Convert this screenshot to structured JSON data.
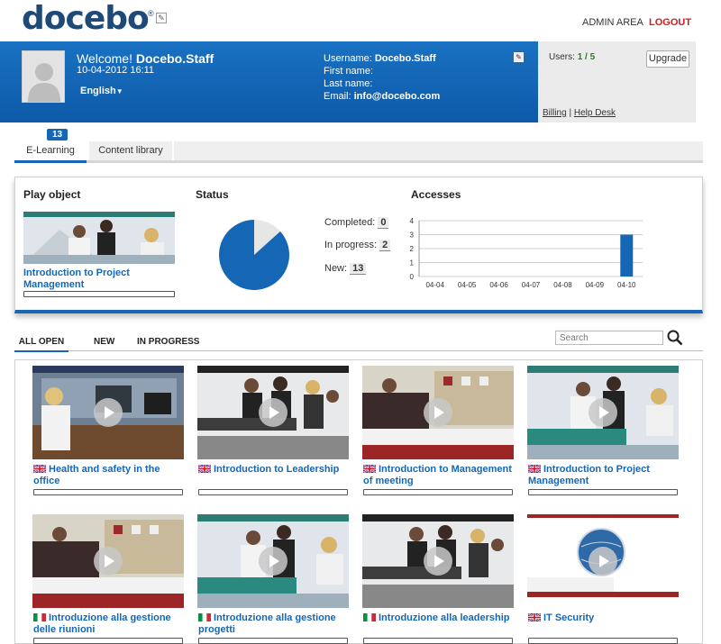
{
  "brand": {
    "logo_text": "docebo",
    "logo_mark": "®"
  },
  "topnav": {
    "admin": "ADMIN AREA",
    "logout": "LOGOUT"
  },
  "user": {
    "welcome_prefix": "Welcome!",
    "name": "Docebo.Staff",
    "datetime": "10-04-2012 16:11",
    "language": "English",
    "username_label": "Username:",
    "username": "Docebo.Staff",
    "first_name_label": "First name:",
    "last_name_label": "Last name:",
    "email_label": "Email:",
    "email": "info@docebo.com"
  },
  "side": {
    "users_label": "Users:",
    "users_count": "1 / 5",
    "upgrade": "Upgrade",
    "billing": "Billing",
    "separator": "|",
    "helpdesk": "Help Desk"
  },
  "tabs": {
    "badge": "13",
    "elearning": "E-Learning",
    "content_library": "Content library"
  },
  "dashboard": {
    "play_heading": "Play object",
    "status_heading": "Status",
    "accesses_heading": "Accesses",
    "play_title": "Introduction to Project Management",
    "completed_label": "Completed:",
    "completed": "0",
    "in_progress_label": "In progress:",
    "in_progress": "2",
    "new_label": "New:",
    "new": "13"
  },
  "chart_data": {
    "type": "bar",
    "categories": [
      "04-04",
      "04-05",
      "04-06",
      "04-07",
      "04-08",
      "04-09",
      "04-10"
    ],
    "values": [
      0,
      0,
      0,
      0,
      0,
      0,
      3
    ],
    "yticks": [
      0,
      1,
      2,
      3,
      4
    ],
    "ylim": [
      0,
      4
    ],
    "color": "#1567b6"
  },
  "status_pie": {
    "type": "pie",
    "labels": [
      "Completed",
      "In progress",
      "New"
    ],
    "values": [
      0,
      2,
      13
    ],
    "colors": [
      "#1567b6",
      "#e6e6e6",
      "#1567b6"
    ]
  },
  "filters": {
    "all": "ALL OPEN",
    "new": "NEW",
    "progress": "IN PROGRESS",
    "search_placeholder": "Search"
  },
  "courses": [
    {
      "title": "Health and safety in the office",
      "flag": "uk"
    },
    {
      "title": "Introduction to Leadership",
      "flag": "uk"
    },
    {
      "title": "Introduction to Management of meeting",
      "flag": "uk"
    },
    {
      "title": "Introduction to Project Management",
      "flag": "uk"
    },
    {
      "title": "Introduzione alla gestione delle riunioni",
      "flag": "it"
    },
    {
      "title": "Introduzione alla gestione progetti",
      "flag": "it"
    },
    {
      "title": "Introduzione alla leadership",
      "flag": "it"
    },
    {
      "title": "IT Security",
      "flag": "uk"
    }
  ]
}
